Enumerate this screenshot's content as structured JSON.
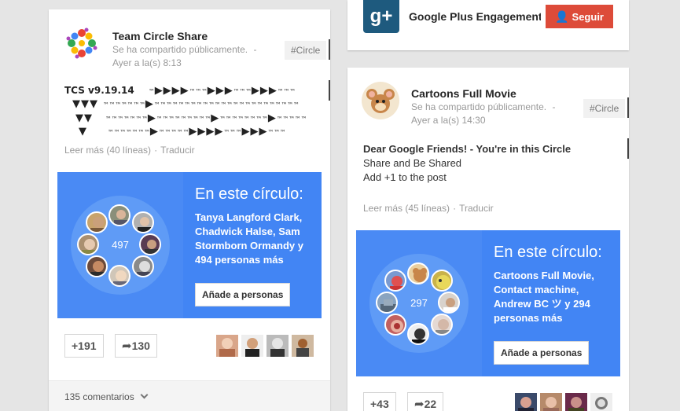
{
  "left_post": {
    "author": "Team Circle Share",
    "visibility": "Se ha compartido públicamente.",
    "dash": "-",
    "timestamp": "Ayer a la(s) 8:13",
    "tag": "#Circle",
    "tcs_title": "TCS v9.19.14",
    "read_more": "Leer más (40 líneas)",
    "translate": "Traducir",
    "circle": {
      "title": "En este círculo:",
      "count": "497",
      "description": "Tanya Langford Clark, Chadwick Halse, Sam Stormborn Ormandy y 494 personas más",
      "add_button": "Añade a personas"
    },
    "plus_count": "+191",
    "share_count": "130",
    "comments": "135 comentarios"
  },
  "top_right_post": {
    "author": "Google Plus Engagement C",
    "follow_button": "Seguir"
  },
  "right_post": {
    "author": "Cartoons Full Movie",
    "visibility": "Se ha compartido públicamente.",
    "dash": "-",
    "timestamp": "Ayer a la(s) 14:30",
    "tag": "#Circle",
    "lines": [
      "Dear Google Friends! - You're in this Circle",
      "Share and Be Shared",
      "Add +1 to the post"
    ],
    "read_more": "Leer más (45 líneas)",
    "translate": "Traducir",
    "circle": {
      "title": "En este círculo:",
      "count": "297",
      "description": "Cartoons Full Movie, Contact machine, Andrew BC ツ y 294 personas más",
      "add_button": "Añade a personas"
    },
    "plus_count": "+43",
    "share_count": "22"
  },
  "colors": {
    "circle_blue": "#4285f4",
    "follow_red": "#dd4b39",
    "background": "#e5e5e5"
  }
}
